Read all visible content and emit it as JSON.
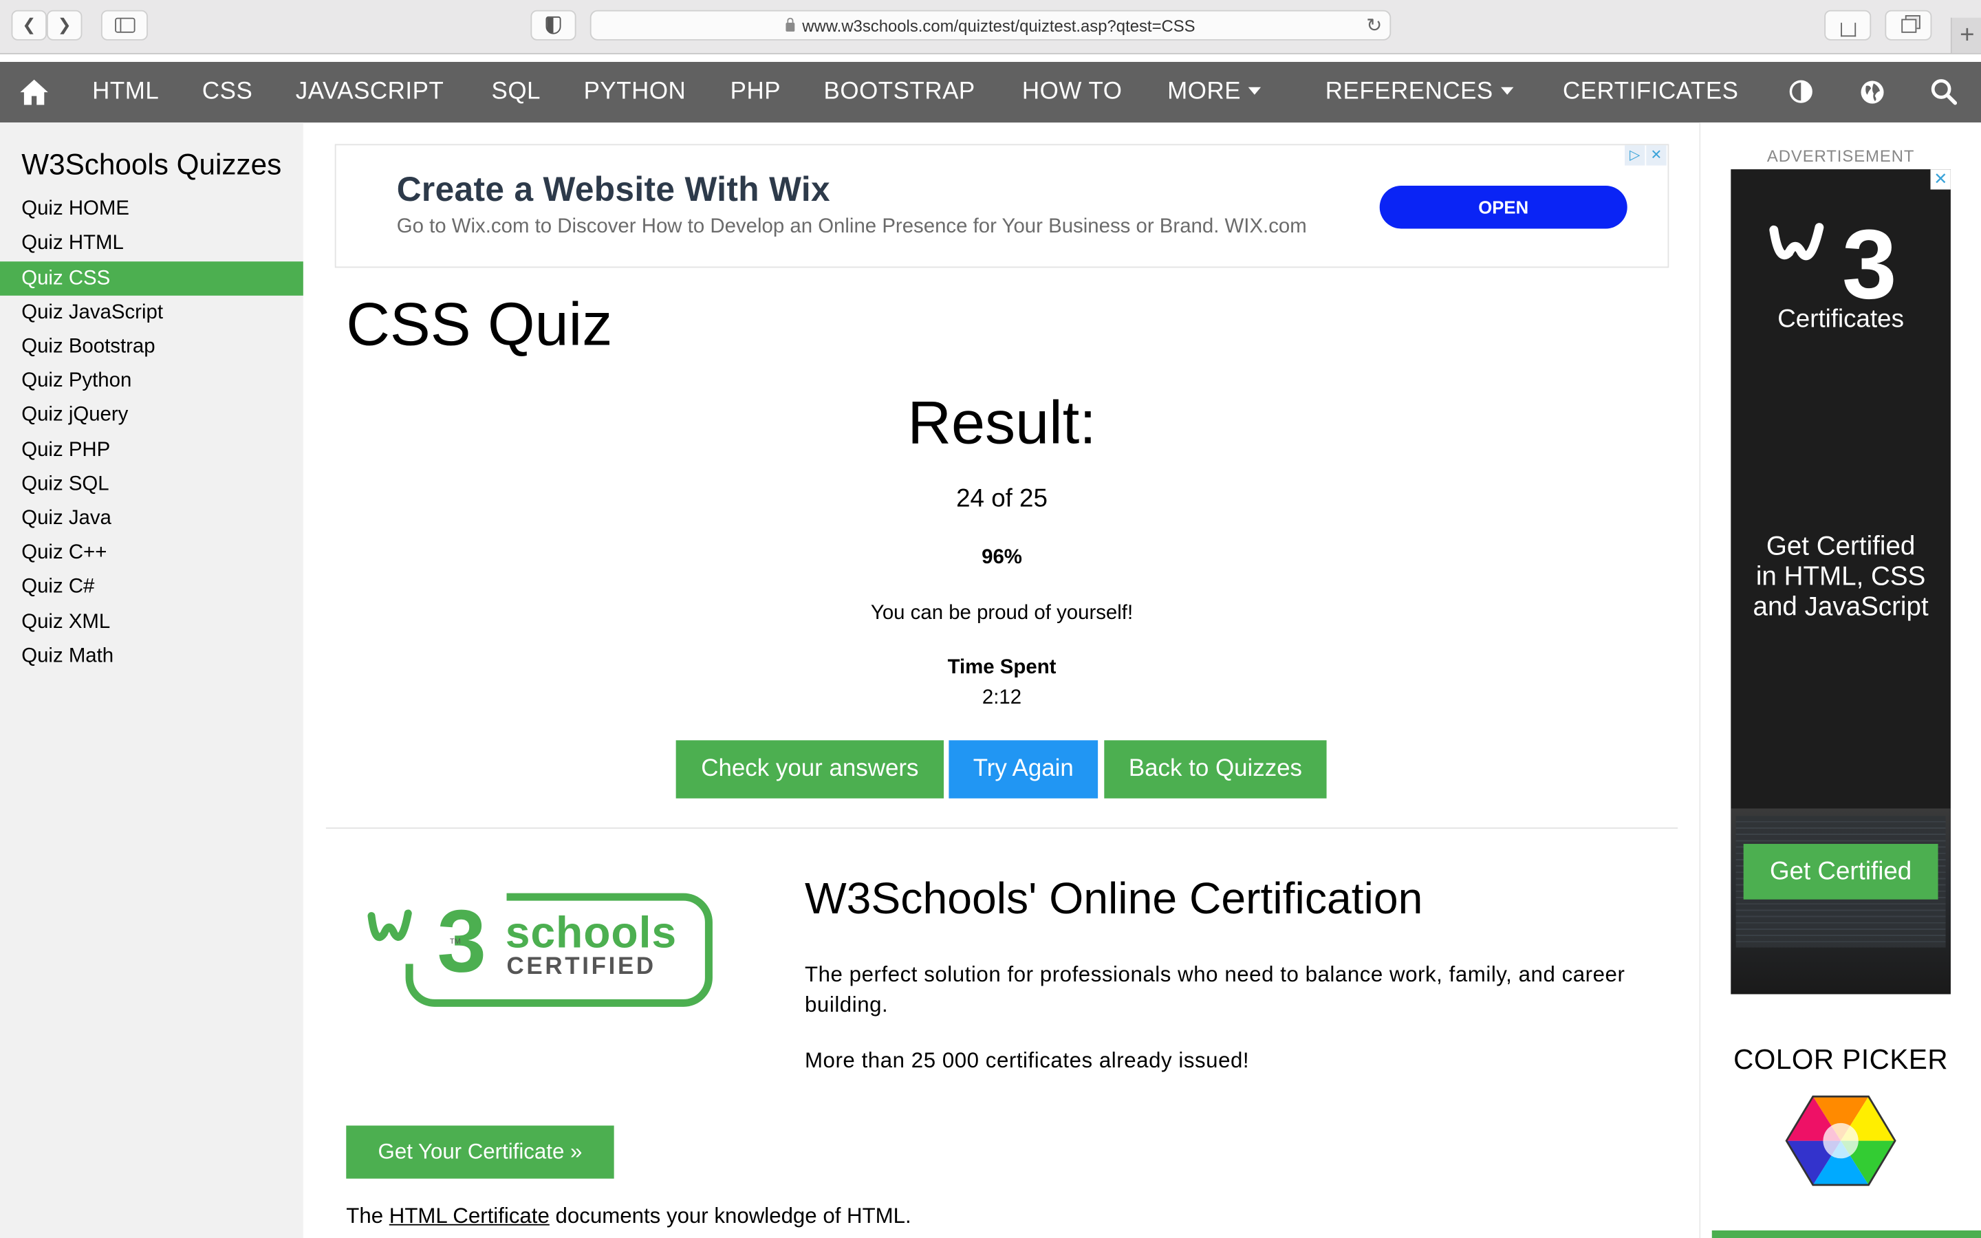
{
  "browser": {
    "url": "www.w3schools.com/quiztest/quiztest.asp?qtest=CSS"
  },
  "nav": {
    "items": [
      "HTML",
      "CSS",
      "JAVASCRIPT",
      "SQL",
      "PYTHON",
      "PHP",
      "BOOTSTRAP",
      "HOW TO",
      "MORE",
      "REFERENCES",
      "CERTIFICATES"
    ]
  },
  "sidebar": {
    "title": "W3Schools Quizzes",
    "items": [
      "Quiz HOME",
      "Quiz HTML",
      "Quiz CSS",
      "Quiz JavaScript",
      "Quiz Bootstrap",
      "Quiz Python",
      "Quiz jQuery",
      "Quiz PHP",
      "Quiz SQL",
      "Quiz Java",
      "Quiz C++",
      "Quiz C#",
      "Quiz XML",
      "Quiz Math"
    ],
    "active": "Quiz CSS"
  },
  "ad": {
    "title": "Create a Website With Wix",
    "subtitle": "Go to Wix.com to Discover How to Develop an Online Presence for Your Business or Brand. WIX.com",
    "button": "OPEN"
  },
  "quiz": {
    "title": "CSS Quiz",
    "result_heading": "Result:",
    "score": "24 of 25",
    "percent": "96%",
    "message": "You can be proud of yourself!",
    "time_label": "Time Spent",
    "time_value": "2:12",
    "btn_check": "Check your answers",
    "btn_try": "Try Again",
    "btn_back": "Back to Quizzes"
  },
  "cert": {
    "logo_schools": "schools",
    "logo_certified": "CERTIFIED",
    "title": "W3Schools' Online Certification",
    "p1": "The perfect solution for professionals who need to balance work, family, and career building.",
    "p2": "More than 25 000 certificates already issued!",
    "button": "Get Your Certificate »",
    "footer_prefix": "The ",
    "footer_link": "HTML Certificate",
    "footer_suffix": " documents your knowledge of HTML."
  },
  "right": {
    "advert_label": "ADVERTISEMENT",
    "sky_certificates": "Certificates",
    "sky_line1": "Get Certified",
    "sky_line2": "in HTML, CSS",
    "sky_line3": "and JavaScript",
    "sky_button": "Get Certified",
    "color_picker": "COLOR PICKER"
  },
  "colors": {
    "nav_bg": "#616161",
    "green": "#4caf50",
    "blue": "#2196f3",
    "sidebar_bg": "#f1f1f1",
    "ad_button": "#0a24f5"
  }
}
